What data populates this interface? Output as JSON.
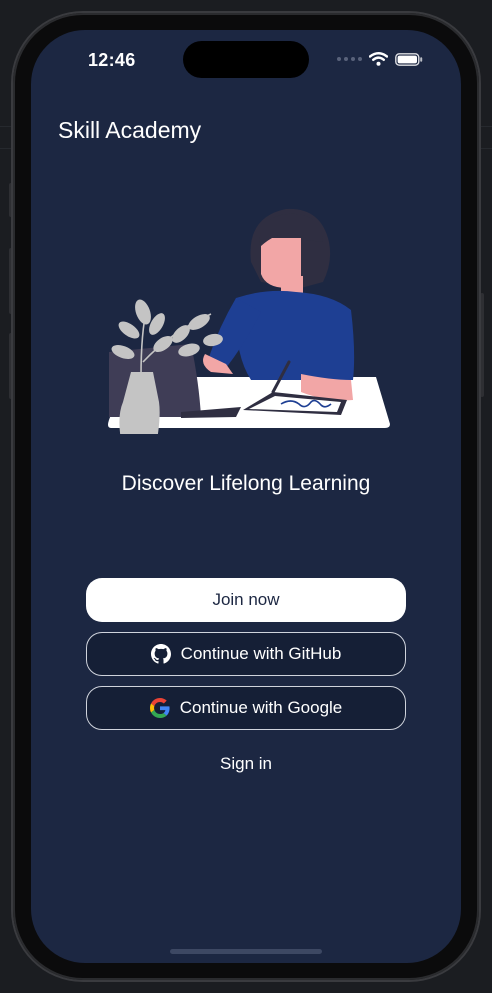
{
  "status_bar": {
    "time": "12:46"
  },
  "app": {
    "title": "Skill Academy"
  },
  "hero": {
    "tagline": "Discover Lifelong Learning"
  },
  "actions": {
    "join_label": "Join now",
    "github_label": "Continue with GitHub",
    "google_label": "Continue with Google",
    "signin_label": "Sign in"
  },
  "icons": {
    "github": "github-icon",
    "google": "google-icon",
    "wifi": "wifi-icon",
    "battery": "battery-icon"
  },
  "colors": {
    "background": "#1c2742",
    "primary_button": "#ffffff",
    "shirt": "#1e3f93",
    "skin": "#f2a6a6"
  }
}
